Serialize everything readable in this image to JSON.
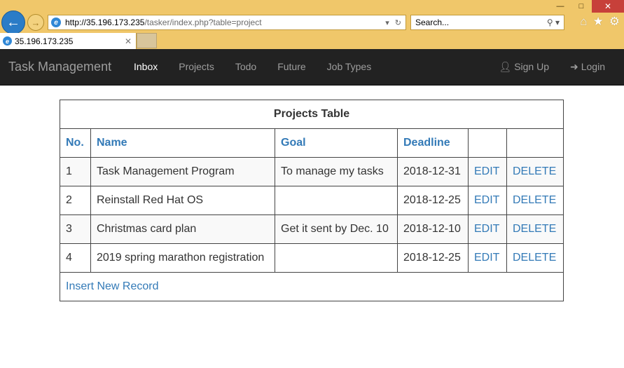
{
  "browser": {
    "url_host": "http://35.196.173.235",
    "url_rest": "/tasker/index.php?table=project",
    "search_placeholder": "Search...",
    "tab_title": "35.196.173.235"
  },
  "navbar": {
    "brand": "Task Management",
    "items": [
      "Inbox",
      "Projects",
      "Todo",
      "Future",
      "Job Types"
    ],
    "active": "Inbox",
    "signup": "Sign Up",
    "login": "Login"
  },
  "table": {
    "caption": "Projects Table",
    "headers": [
      "No.",
      "Name",
      "Goal",
      "Deadline",
      "",
      ""
    ],
    "rows": [
      {
        "no": "1",
        "name": "Task Management Program",
        "goal": "To manage my tasks",
        "deadline": "2018-12-31",
        "edit": "EDIT",
        "delete": "DELETE"
      },
      {
        "no": "2",
        "name": "Reinstall Red Hat OS",
        "goal": "",
        "deadline": "2018-12-25",
        "edit": "EDIT",
        "delete": "DELETE"
      },
      {
        "no": "3",
        "name": "Christmas card plan",
        "goal": "Get it sent by Dec. 10",
        "deadline": "2018-12-10",
        "edit": "EDIT",
        "delete": "DELETE"
      },
      {
        "no": "4",
        "name": "2019 spring marathon registration",
        "goal": "",
        "deadline": "2018-12-25",
        "edit": "EDIT",
        "delete": "DELETE"
      }
    ],
    "insert_label": "Insert New Record"
  },
  "colors": {
    "link": "#337ab7",
    "navbar_bg": "#222222",
    "chrome_bg": "#f0c76a"
  }
}
